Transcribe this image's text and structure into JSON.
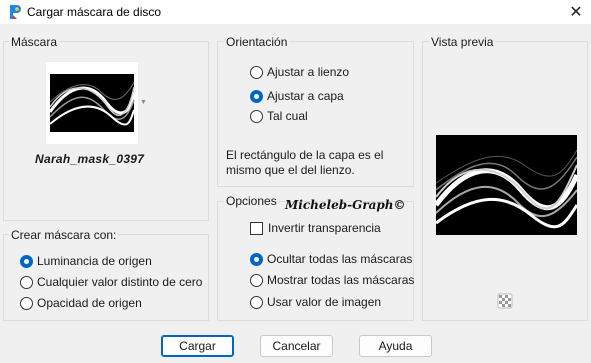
{
  "window": {
    "title": "Cargar máscara de disco",
    "close_label": "✕"
  },
  "mask": {
    "group_title": "Máscara",
    "mask_name": "Narah_mask_0397"
  },
  "orientation": {
    "group_title": "Orientación",
    "options": [
      {
        "label": "Ajustar a lienzo",
        "checked": false
      },
      {
        "label": "Ajustar a capa",
        "checked": true
      },
      {
        "label": "Tal cual",
        "checked": false
      }
    ],
    "description": "El rectángulo de la capa es el mismo que el del lienzo."
  },
  "preview": {
    "group_title": "Vista previa"
  },
  "create_mask": {
    "group_title": "Crear máscara con:",
    "options": [
      {
        "label": "Luminancia de origen",
        "checked": true
      },
      {
        "label": "Cualquier valor distinto de cero",
        "checked": false
      },
      {
        "label": "Opacidad de origen",
        "checked": false
      }
    ]
  },
  "options": {
    "group_title": "Opciones",
    "watermark": "Micheleb-Graph©",
    "invert_label": "Invertir transparencia",
    "invert_checked": false,
    "radios": [
      {
        "label": "Ocultar todas las máscaras",
        "checked": true
      },
      {
        "label": "Mostrar todas las máscaras",
        "checked": false
      },
      {
        "label": "Usar valor de imagen",
        "checked": false
      }
    ]
  },
  "buttons": {
    "load": "Cargar",
    "cancel": "Cancelar",
    "help": "Ayuda"
  },
  "colors": {
    "accent": "#0067c0",
    "background": "#f0f0f0",
    "border": "#dcdcdc"
  },
  "icons": {
    "app": "paintshop-icon",
    "transparency": "checkerboard-icon"
  }
}
